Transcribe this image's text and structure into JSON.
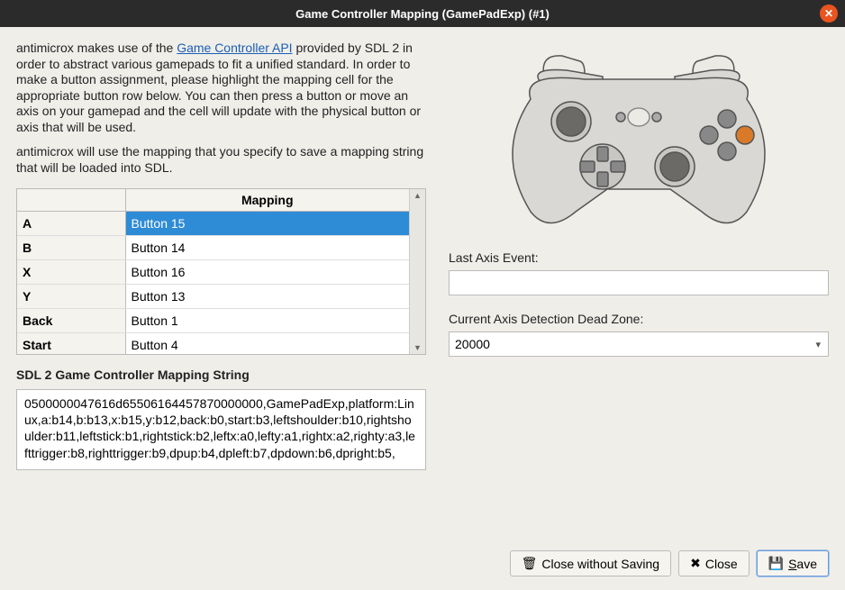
{
  "window": {
    "title": "Game Controller Mapping (GamePadExp) (#1)"
  },
  "intro": {
    "p1a": "antimicrox makes use of the ",
    "link": "Game Controller API",
    "p1b": " provided by SDL 2 in order to abstract various gamepads to fit a unified standard. In order to make a button assignment, please highlight the mapping cell for the appropriate button row below. You can then press a button or move an axis on your gamepad and the cell will update with the physical button or axis that will be used.",
    "p2": "antimicrox will use the mapping that you specify to save a mapping string that will be loaded into SDL."
  },
  "table": {
    "header_blank": "",
    "header_mapping": "Mapping",
    "rows": [
      {
        "name": "A",
        "mapping": "Button 15",
        "selected": true
      },
      {
        "name": "B",
        "mapping": "Button 14",
        "selected": false
      },
      {
        "name": "X",
        "mapping": "Button 16",
        "selected": false
      },
      {
        "name": "Y",
        "mapping": "Button 13",
        "selected": false
      },
      {
        "name": "Back",
        "mapping": "Button 1",
        "selected": false
      },
      {
        "name": "Start",
        "mapping": "Button 4",
        "selected": false
      }
    ]
  },
  "mapping_string": {
    "label": "SDL 2 Game Controller Mapping String",
    "value": "0500000047616d65506164457870000000,GamePadExp,platform:Linux,a:b14,b:b13,x:b15,y:b12,back:b0,start:b3,leftshoulder:b10,rightshoulder:b11,leftstick:b1,rightstick:b2,leftx:a0,lefty:a1,rightx:a2,righty:a3,lefttrigger:b8,righttrigger:b9,dpup:b4,dpleft:b7,dpdown:b6,dpright:b5,"
  },
  "right": {
    "last_axis_label": "Last Axis Event:",
    "last_axis_value": "",
    "deadzone_label": "Current Axis Detection Dead Zone:",
    "deadzone_value": "20000"
  },
  "buttons": {
    "close_no_save": "Close without Saving",
    "close": "Close",
    "save_prefix": "S",
    "save_rest": "ave"
  }
}
